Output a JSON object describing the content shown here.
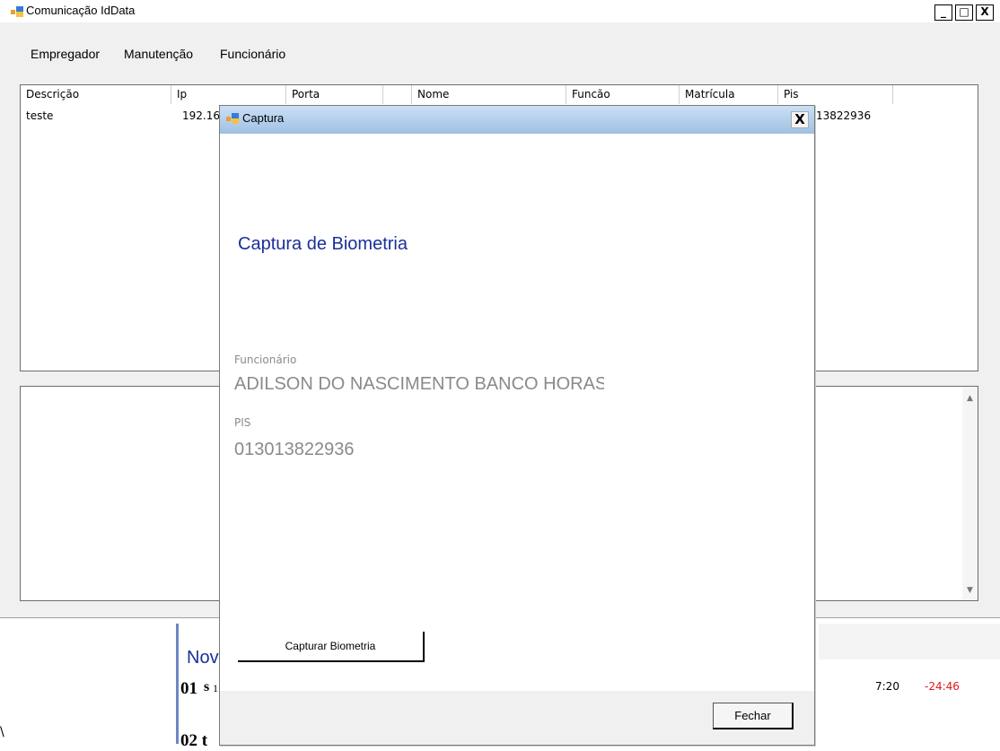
{
  "main_window": {
    "title": "Comunicação IdData",
    "controls": {
      "minimize": "_",
      "maximize": "□",
      "close": "X"
    }
  },
  "menu": {
    "items": [
      "Empregador",
      "Manutenção",
      "Funcionário"
    ]
  },
  "listview": {
    "columns": [
      "Descrição",
      "Ip",
      "Porta",
      "Nome",
      "Funcão",
      "Matrícula",
      "Pis"
    ],
    "row": {
      "descricao": "teste",
      "ip": "192.16",
      "pis": "13822936"
    }
  },
  "background": {
    "month": "Nov",
    "day1": "01",
    "day1_sub": "s",
    "day1_sub2": "1",
    "day2": "02 t",
    "time1": "7:20",
    "time2": "-24:46",
    "left_char": "\\"
  },
  "dialog": {
    "title": "Captura",
    "close": "X",
    "heading": "Captura de Biometria",
    "funcionario_label": "Funcionário",
    "funcionario_value": "ADILSON DO NASCIMENTO BANCO HORAS",
    "pis_label": "PIS",
    "pis_value": "013013822936",
    "capture_button": "Capturar Biometria",
    "close_button": "Fechar"
  },
  "colors": {
    "heading": "#1b2f9a",
    "negative_time": "#e01818",
    "dialog_titlebar": "#9fc0e3"
  }
}
